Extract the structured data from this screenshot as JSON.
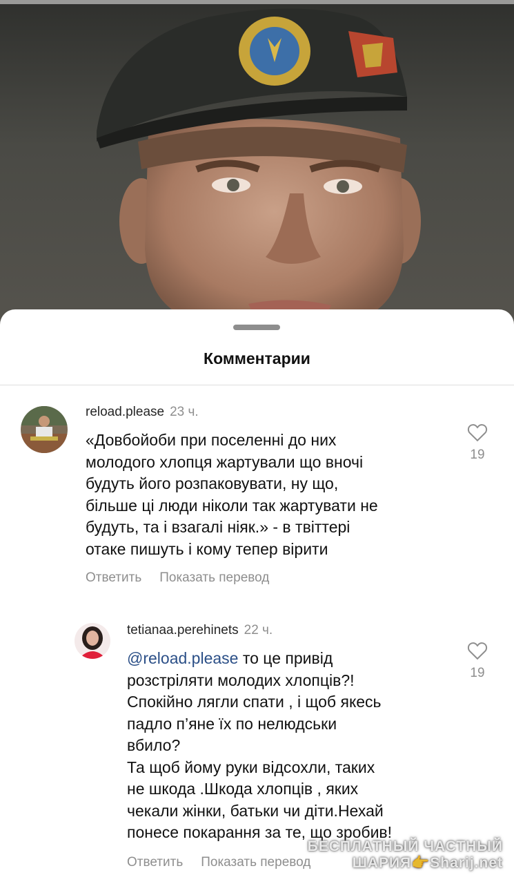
{
  "sheet": {
    "title": "Комментарии"
  },
  "comments": [
    {
      "username": "reload.please",
      "time": "23 ч.",
      "text": "«Довбойоби при поселенні до них\nмолодого хлопця жартували що вночі\nбудуть його розпаковувати, ну що,\nбільше ці люди ніколи так жартувати не\nбудуть, та і взагалі ніяк.» - в твіттері\nотаке пишуть і кому тепер вірити",
      "likes": "19",
      "reply_label": "Ответить",
      "translate_label": "Показать перевод"
    },
    {
      "username": "tetianaa.perehinets",
      "time": "22 ч.",
      "mention": "@reload.please",
      "text": " то це привід\nрозстріляти молодих хлопців?!\nСпокійно лягли спати ,  і щоб якесь\nпадло п’яне їх по нелюдськи\nвбило?\nТа щоб йому руки відсохли, таких\nне шкода .Шкода хлопців , яких\nчекали жінки, батьки чи діти.Нехай\nпонесе покарання за те, що зробив!",
      "likes": "19",
      "reply_label": "Ответить",
      "translate_label": "Показать перевод"
    }
  ],
  "watermark": {
    "line1": "БЕСПЛАТНЫЙ ЧАСТНЫЙ",
    "line2": "ШАРИЯ👉Sharij.net"
  },
  "colors": {
    "mention": "#2b4f87",
    "muted": "#8e8e8e"
  }
}
